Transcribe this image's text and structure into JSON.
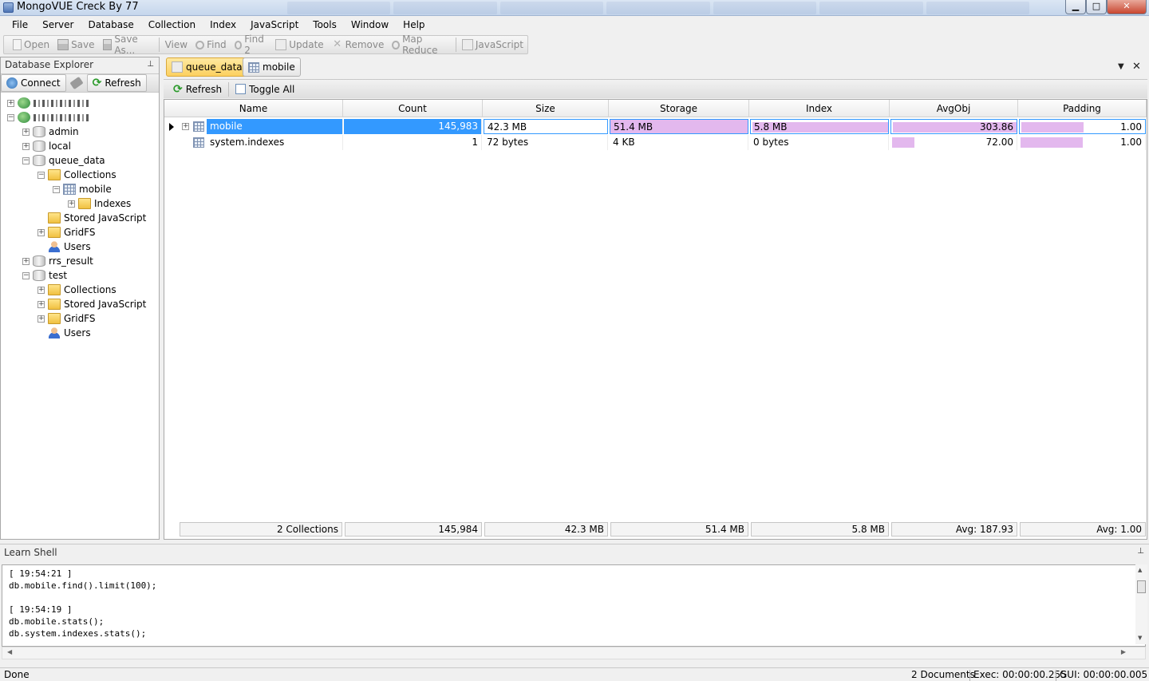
{
  "window": {
    "title": "MongoVUE Creck By 77",
    "min": "▁",
    "max": "□",
    "close": "✕"
  },
  "menu": [
    "File",
    "Server",
    "Database",
    "Collection",
    "Index",
    "JavaScript",
    "Tools",
    "Window",
    "Help"
  ],
  "toolbar": {
    "open": "Open",
    "save": "Save",
    "save_as": "Save As...",
    "view": "View",
    "find": "Find",
    "find2": "Find 2",
    "update": "Update",
    "remove": "Remove",
    "map_reduce": "Map Reduce",
    "javascript": "JavaScript"
  },
  "explorer": {
    "title": "Database Explorer",
    "pin": "⊥",
    "connect": "Connect",
    "refresh": "Refresh",
    "tree": {
      "admin": "admin",
      "local": "local",
      "queue_data": "queue_data",
      "collections": "Collections",
      "mobile": "mobile",
      "indexes": "Indexes",
      "stored_js": "Stored JavaScript",
      "gridfs": "GridFS",
      "users": "Users",
      "rrs_result": "rrs_result",
      "test": "test",
      "test_collections": "Collections",
      "test_stored_js": "Stored JavaScript",
      "test_gridfs": "GridFS",
      "test_users": "Users"
    }
  },
  "tabs": {
    "queue_data": "queue_data",
    "mobile": "mobile",
    "dropdown": "▼",
    "close": "✕"
  },
  "subtoolbar": {
    "refresh": "Refresh",
    "toggle_all": "Toggle All"
  },
  "grid": {
    "columns": [
      "Name",
      "Count",
      "Size",
      "Storage",
      "Index",
      "AvgObj",
      "Padding"
    ],
    "rows": [
      {
        "name": "mobile",
        "count": "145,983",
        "size": "42.3 MB",
        "storage": "51.4 MB",
        "index": "5.8 MB",
        "avgobj": "303.86",
        "padding": "1.00",
        "index_fill": 1.0,
        "avgobj_fill": 1.0,
        "padding_fill": 0.5
      },
      {
        "name": "system.indexes",
        "count": "1",
        "size": "72 bytes",
        "storage": "4 KB",
        "index": "0 bytes",
        "avgobj": "72.00",
        "padding": "1.00",
        "index_fill": 0.0,
        "avgobj_fill": 0.18,
        "padding_fill": 0.5
      }
    ],
    "footer": {
      "name": "2 Collections",
      "count": "145,984",
      "size": "42.3 MB",
      "storage": "51.4 MB",
      "index": "5.8 MB",
      "avgobj": "Avg: 187.93",
      "padding": "Avg: 1.00"
    }
  },
  "shell": {
    "title": "Learn Shell",
    "pin": "⊥",
    "lines": [
      "[ 19:54:21 ]",
      "db.mobile.find().limit(100);",
      "",
      "[ 19:54:19 ]",
      "db.mobile.stats();",
      "db.system.indexes.stats();"
    ]
  },
  "status": {
    "left": "Done",
    "documents": "2 Documents",
    "exec": "Exec:  00:00:00.255",
    "gui": "GUI:  00:00:00.005"
  },
  "colors": {
    "selection": "#3399ff",
    "bar": "#e3b8ee",
    "active_tab": "#fcd060"
  }
}
